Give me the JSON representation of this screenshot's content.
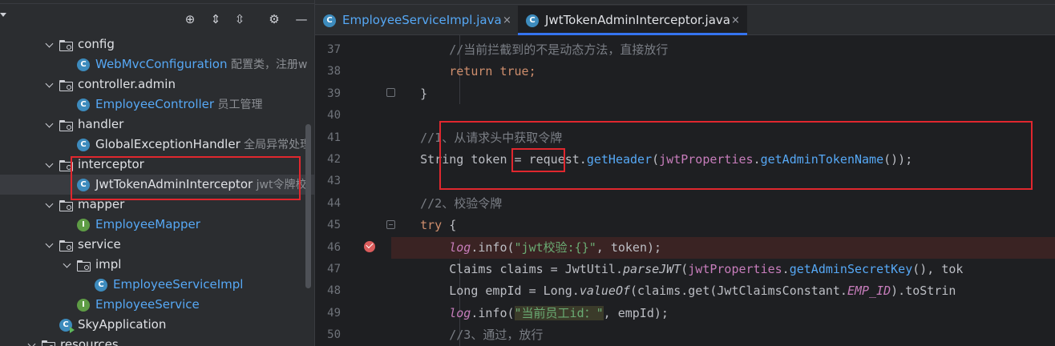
{
  "project_tree": [
    {
      "indent": 1,
      "chevron": true,
      "icon": "folder",
      "label": "config"
    },
    {
      "indent": 2,
      "chevron": false,
      "icon": "class",
      "label": "WebMvcConfiguration",
      "hint": "配置类，注册w",
      "color": "blue"
    },
    {
      "indent": 1,
      "chevron": true,
      "icon": "folder",
      "label": "controller.admin"
    },
    {
      "indent": 2,
      "chevron": false,
      "icon": "class",
      "label": "EmployeeController",
      "hint": "员工管理",
      "color": "blue"
    },
    {
      "indent": 1,
      "chevron": true,
      "icon": "folder",
      "label": "handler"
    },
    {
      "indent": 2,
      "chevron": false,
      "icon": "class",
      "label": "GlobalExceptionHandler",
      "hint": "全局异常处理",
      "color": "white"
    },
    {
      "indent": 1,
      "chevron": true,
      "icon": "folder",
      "label": "interceptor"
    },
    {
      "indent": 2,
      "chevron": false,
      "icon": "class",
      "label": "JwtTokenAdminInterceptor",
      "hint": "jwt令牌校",
      "color": "white",
      "selected": true
    },
    {
      "indent": 1,
      "chevron": true,
      "icon": "folder",
      "label": "mapper"
    },
    {
      "indent": 2,
      "chevron": false,
      "icon": "interface",
      "label": "EmployeeMapper",
      "color": "blue"
    },
    {
      "indent": 1,
      "chevron": true,
      "icon": "folder",
      "label": "service"
    },
    {
      "indent": 2,
      "chevron": true,
      "icon": "folder",
      "label": "impl"
    },
    {
      "indent": 3,
      "chevron": false,
      "icon": "class",
      "label": "EmployeeServiceImpl",
      "color": "blue"
    },
    {
      "indent": 2,
      "chevron": false,
      "icon": "interface",
      "label": "EmployeeService",
      "color": "blue"
    },
    {
      "indent": 1,
      "chevron": false,
      "icon": "app",
      "label": "SkyApplication",
      "color": "white"
    },
    {
      "indent": 0,
      "chevron": true,
      "icon": "folder",
      "label": "resources"
    }
  ],
  "toolbar": {
    "locate_icon": "⊕",
    "expand_icon": "⇕",
    "collapse_icon": "⇳",
    "settings_icon": "⚙",
    "hide_icon": "—"
  },
  "tabs": [
    {
      "label": "EmployeeServiceImpl.java",
      "active": false,
      "close": "×"
    },
    {
      "label": "JwtTokenAdminInterceptor.java",
      "active": true,
      "close": "×"
    }
  ],
  "line_numbers": [
    "37",
    "38",
    "39",
    "40",
    "41",
    "42",
    "43",
    "44",
    "45",
    "46",
    "47",
    "48",
    "49",
    "50"
  ],
  "code_lines": [
    [
      {
        "t": "        "
      },
      {
        "t": "//当前拦截到的不是动态方法，直接放行",
        "c": "c"
      }
    ],
    [
      {
        "t": "        "
      },
      {
        "t": "return true",
        "c": "k"
      },
      {
        "t": ";",
        "c": "k"
      }
    ],
    [
      {
        "t": "    }"
      }
    ],
    [
      {
        "t": ""
      }
    ],
    [
      {
        "t": "    "
      },
      {
        "t": "//1、从请求头中获取令牌",
        "c": "c"
      }
    ],
    [
      {
        "t": "    String "
      },
      {
        "t": "token"
      },
      {
        "t": " = request."
      },
      {
        "t": "getHeader",
        "c": "m"
      },
      {
        "t": "("
      },
      {
        "t": "jwtProperties",
        "c": "f"
      },
      {
        "t": "."
      },
      {
        "t": "getAdminTokenName",
        "c": "m"
      },
      {
        "t": "());"
      }
    ],
    [
      {
        "t": ""
      }
    ],
    [
      {
        "t": "    "
      },
      {
        "t": "//2、校验令牌",
        "c": "c"
      }
    ],
    [
      {
        "t": "    "
      },
      {
        "t": "try",
        "c": "k"
      },
      {
        "t": " {"
      }
    ],
    [
      {
        "t": "        "
      },
      {
        "t": "log",
        "c": "f it"
      },
      {
        "t": ".info("
      },
      {
        "t": "\"jwt校验:{}\"",
        "c": "s"
      },
      {
        "t": ", token);"
      }
    ],
    [
      {
        "t": "        Claims claims = JwtUtil."
      },
      {
        "t": "parseJWT",
        "c": "it"
      },
      {
        "t": "("
      },
      {
        "t": "jwtProperties",
        "c": "f"
      },
      {
        "t": "."
      },
      {
        "t": "getAdminSecretKey",
        "c": "m"
      },
      {
        "t": "(), tok"
      }
    ],
    [
      {
        "t": "        Long empId = Long."
      },
      {
        "t": "valueOf",
        "c": "it"
      },
      {
        "t": "(claims.get(JwtClaimsConstant."
      },
      {
        "t": "EMP_ID",
        "c": "f it"
      },
      {
        "t": ").toStrin"
      }
    ],
    [
      {
        "t": "        "
      },
      {
        "t": "log",
        "c": "f it"
      },
      {
        "t": ".info("
      },
      {
        "t": "\"当前员工id：\"",
        "c": "s sel"
      },
      {
        "t": ", empId);"
      }
    ],
    [
      {
        "t": "        "
      },
      {
        "t": "//3、通过，放行",
        "c": "c"
      }
    ]
  ]
}
